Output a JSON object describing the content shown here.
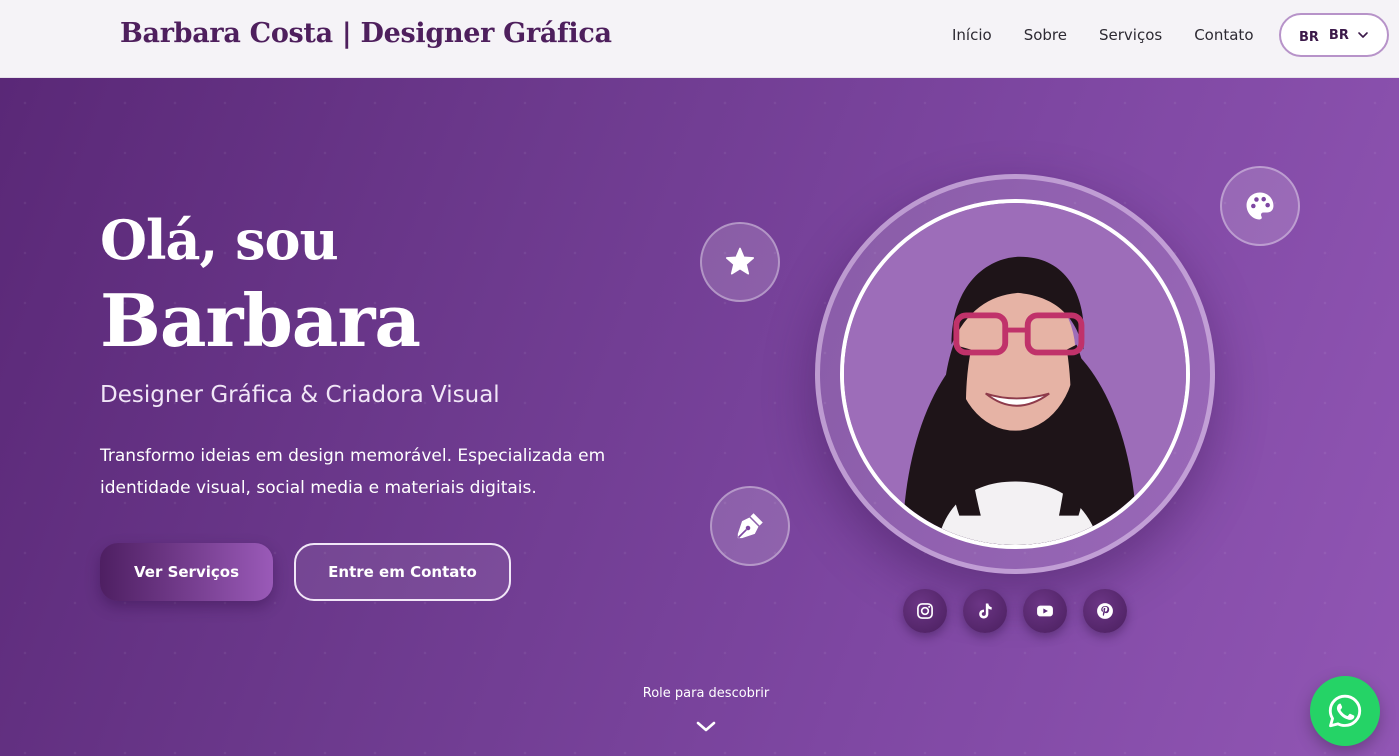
{
  "header": {
    "brand": "Barbara Costa | Designer Gráfica",
    "nav": [
      "Início",
      "Sobre",
      "Serviços",
      "Contato"
    ],
    "language": {
      "flag": "BR",
      "code": "BR"
    }
  },
  "hero": {
    "greeting": "Olá, sou",
    "name": "Barbara",
    "subtitle": "Designer Gráfica & Criadora Visual",
    "description": "Transformo ideias em design memorável. Especializada em identidade visual, social media e materiais digitais.",
    "primary_button": "Ver Serviços",
    "secondary_button": "Entre em Contato",
    "scroll_hint": "Role para descobrir"
  },
  "floating_icons": [
    "star-icon",
    "palette-icon",
    "pen-nib-icon"
  ],
  "socials": [
    "instagram-icon",
    "tiktok-icon",
    "youtube-icon",
    "pinterest-icon"
  ],
  "colors": {
    "brand": "#4e1f5d",
    "hero_start": "#5a2877",
    "hero_end": "#9156b4",
    "whatsapp": "#25d366"
  }
}
